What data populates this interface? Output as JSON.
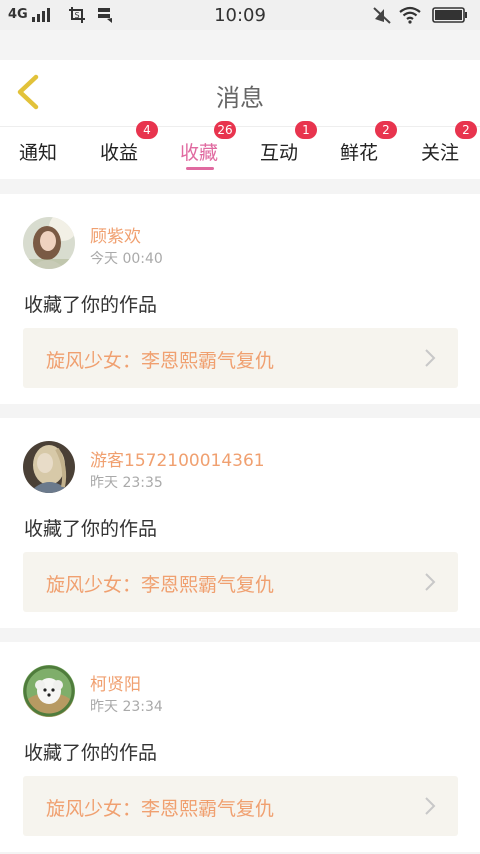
{
  "status_bar": {
    "network": "4G",
    "time": "10:09"
  },
  "header": {
    "title": "消息"
  },
  "tabs": [
    {
      "label": "通知",
      "badge": ""
    },
    {
      "label": "收益",
      "badge": "4"
    },
    {
      "label": "收藏",
      "badge": "26"
    },
    {
      "label": "互动",
      "badge": "1"
    },
    {
      "label": "鲜花",
      "badge": "2"
    },
    {
      "label": "关注",
      "badge": "2"
    }
  ],
  "colors": {
    "accent": "#e06aa0",
    "badge": "#e8344e",
    "name": "#f0a070"
  },
  "messages": [
    {
      "username": "顾紫欢",
      "time": "今天 00:40",
      "text": "收藏了你的作品",
      "work_title": "旋风少女：李恩熙霸气复仇",
      "avatar_icon": "girl-photo-avatar"
    },
    {
      "username": "游客1572100014361",
      "time": "昨天 23:35",
      "text": "收藏了你的作品",
      "work_title": "旋风少女：李恩熙霸气复仇",
      "avatar_icon": "blonde-girl-avatar"
    },
    {
      "username": "柯贤阳",
      "time": "昨天 23:34",
      "text": "收藏了你的作品",
      "work_title": "旋风少女：李恩熙霸气复仇",
      "avatar_icon": "white-dog-avatar"
    }
  ]
}
